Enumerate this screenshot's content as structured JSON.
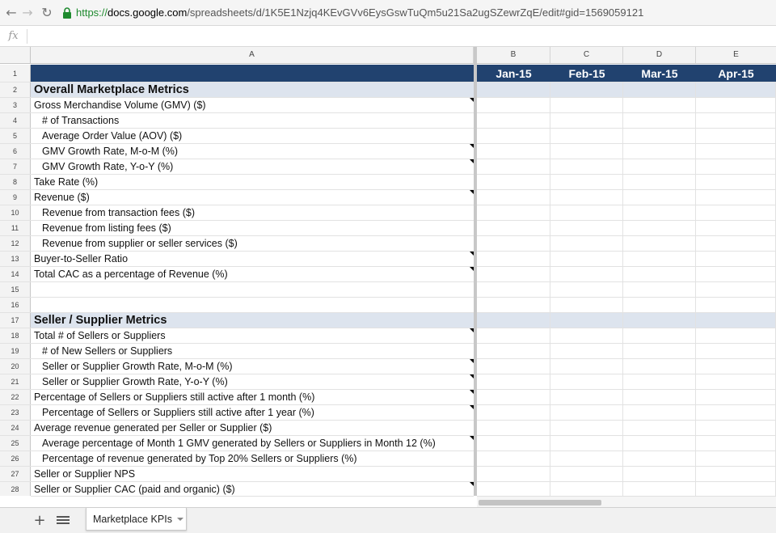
{
  "browser": {
    "url_scheme": "https://",
    "url_host": "docs.google.com",
    "url_path": "/spreadsheets/d/1K5E1Nzjq4KEvGVv6EysGswTuQm5u21Sa2ugSZewrZqE/edit#gid=1569059121"
  },
  "formula_bar": {
    "fx_label": "fx",
    "value": ""
  },
  "columns": [
    "A",
    "B",
    "C",
    "D",
    "E"
  ],
  "months": [
    "Jan-15",
    "Feb-15",
    "Mar-15",
    "Apr-15"
  ],
  "rows": [
    {
      "num": "1",
      "text": "",
      "kind": "header"
    },
    {
      "num": "2",
      "text": "Overall Marketplace Metrics",
      "kind": "section"
    },
    {
      "num": "3",
      "text": "Gross Merchandise Volume (GMV) ($)",
      "kind": "plain",
      "note": true
    },
    {
      "num": "4",
      "text": "# of Transactions",
      "kind": "indent"
    },
    {
      "num": "5",
      "text": "Average Order Value (AOV) ($)",
      "kind": "indent"
    },
    {
      "num": "6",
      "text": "GMV Growth Rate, M-o-M (%)",
      "kind": "indent",
      "note": true
    },
    {
      "num": "7",
      "text": "GMV Growth Rate, Y-o-Y (%)",
      "kind": "indent",
      "note": true
    },
    {
      "num": "8",
      "text": "Take Rate (%)",
      "kind": "plain"
    },
    {
      "num": "9",
      "text": "Revenue ($)",
      "kind": "plain",
      "note": true
    },
    {
      "num": "10",
      "text": "Revenue from transaction fees ($)",
      "kind": "indent"
    },
    {
      "num": "11",
      "text": "Revenue from listing fees ($)",
      "kind": "indent"
    },
    {
      "num": "12",
      "text": "Revenue from supplier or seller services ($)",
      "kind": "indent"
    },
    {
      "num": "13",
      "text": "Buyer-to-Seller Ratio",
      "kind": "plain",
      "note": true
    },
    {
      "num": "14",
      "text": "Total CAC as a percentage of Revenue (%)",
      "kind": "plain",
      "note": true
    },
    {
      "num": "15",
      "text": "",
      "kind": "plain"
    },
    {
      "num": "16",
      "text": "",
      "kind": "plain"
    },
    {
      "num": "17",
      "text": "Seller / Supplier Metrics",
      "kind": "section"
    },
    {
      "num": "18",
      "text": "Total # of Sellers or Suppliers",
      "kind": "plain",
      "note": true
    },
    {
      "num": "19",
      "text": "# of New Sellers or Suppliers",
      "kind": "indent"
    },
    {
      "num": "20",
      "text": "Seller or Supplier Growth Rate, M-o-M (%)",
      "kind": "indent",
      "note": true
    },
    {
      "num": "21",
      "text": "Seller or Supplier Growth Rate, Y-o-Y (%)",
      "kind": "indent",
      "note": true
    },
    {
      "num": "22",
      "text": "Percentage of Sellers or Suppliers still active after 1 month (%)",
      "kind": "plain",
      "note": true
    },
    {
      "num": "23",
      "text": "Percentage of Sellers or Suppliers still active after 1 year (%)",
      "kind": "indent",
      "note": true
    },
    {
      "num": "24",
      "text": "Average revenue generated per Seller or Supplier ($)",
      "kind": "plain"
    },
    {
      "num": "25",
      "text": "Average percentage of Month 1 GMV generated by Sellers or Suppliers in Month 12 (%)",
      "kind": "indent",
      "note": true
    },
    {
      "num": "26",
      "text": "Percentage of revenue generated by Top 20% Sellers or Suppliers (%)",
      "kind": "indent"
    },
    {
      "num": "27",
      "text": "Seller or Supplier NPS",
      "kind": "plain"
    },
    {
      "num": "28",
      "text": "Seller or Supplier CAC (paid and organic) ($)",
      "kind": "plain",
      "note": true
    }
  ],
  "sheet_tabs": [
    {
      "label": "Marketplace KPIs"
    }
  ],
  "colors": {
    "header_bg": "#21426f",
    "section_bg": "#dde4ee",
    "https_green": "#1e8a2e"
  }
}
